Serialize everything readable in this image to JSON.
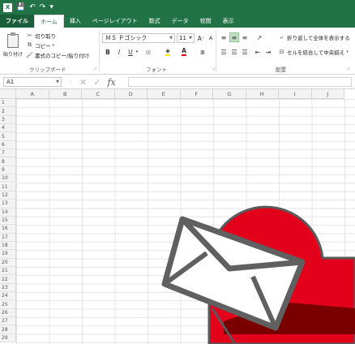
{
  "app": {
    "logo_text": "X",
    "quick_access": [
      "💾",
      "↶",
      "↷",
      "▾"
    ]
  },
  "tabs": [
    "ファイル",
    "ホーム",
    "挿入",
    "ページレイアウト",
    "数式",
    "データ",
    "校閲",
    "表示"
  ],
  "active_tab": "ホーム",
  "ribbon": {
    "clipboard": {
      "paste": "貼り付け",
      "cut": "切り取り",
      "copy": "コピー",
      "format_painter": "書式のコピー/貼り付け",
      "group_label": "クリップボード"
    },
    "font": {
      "font_name": "ＭＳ Ｐゴシック",
      "font_size": "11",
      "grow": "A",
      "shrink": "A",
      "bold": "B",
      "italic": "I",
      "underline": "U",
      "group_label": "フォント"
    },
    "alignment": {
      "wrap_text": "折り返して全体を表示する",
      "merge_center": "セルを結合して中央揃え",
      "group_label": "配置"
    }
  },
  "formula_bar": {
    "name_box": "A1",
    "fx": "fx",
    "cancel": "✕",
    "enter": "✓",
    "value": ""
  },
  "grid": {
    "columns": [
      "A",
      "B",
      "C",
      "D",
      "E",
      "F",
      "G",
      "H",
      "I",
      "J"
    ],
    "rows": [
      "1",
      "2",
      "3",
      "4",
      "5",
      "6",
      "7",
      "8",
      "9",
      "10",
      "11",
      "12",
      "13",
      "14",
      "15",
      "16",
      "17",
      "18",
      "19",
      "20",
      "21",
      "22",
      "23",
      "24",
      "25",
      "26",
      "27",
      "28",
      "29"
    ]
  },
  "colors": {
    "brand": "#217346",
    "badge_red": "#e3001b",
    "envelope_gray": "#606060"
  },
  "icons": {
    "overlay": "mail-envelope-icon"
  }
}
